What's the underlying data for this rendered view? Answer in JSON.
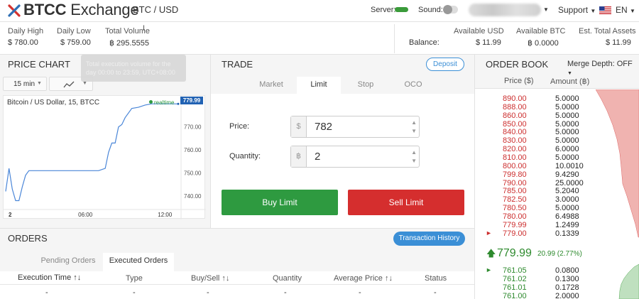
{
  "header": {
    "brand_bold": "BTCC",
    "brand_light": " Exchange",
    "pair": "BTC / USD",
    "server_label": "Server:",
    "sound_label": "Sound:",
    "support_label": "Support",
    "lang_label": "EN",
    "colors": {
      "server_ok": "#3a9b3a",
      "logo_red": "#d5332f",
      "logo_blue": "#2e6fb5"
    }
  },
  "stats": {
    "daily_high_label": "Daily High",
    "daily_high_value": "$ 780.00",
    "daily_low_label": "Daily Low",
    "daily_low_value": "$ 759.00",
    "total_volume_label": "Total Volume",
    "total_volume_value": "฿ 295.5555",
    "balance_label": "Balance:",
    "avail_usd_label": "Available USD",
    "avail_usd_value": "$ 11.99",
    "avail_btc_label": "Available BTC",
    "avail_btc_value": "฿ 0.0000",
    "est_assets_label": "Est. Total Assets",
    "est_assets_value": "$ 11.99"
  },
  "tooltip": {
    "line1": "Total execution volume for the",
    "line2": "day 00:00 to 23:59, UTC+08:00"
  },
  "price_chart": {
    "title": "PRICE CHART",
    "interval": "15 min",
    "chart_title": "Bitcoin / US Dollar, 15, BTCC",
    "realtime_label": "realtime",
    "current_price_tag": "779.99"
  },
  "chart_data": {
    "type": "line",
    "title": "Bitcoin / US Dollar, 15, BTCC",
    "x_ticks": [
      "2",
      "06:00",
      "12:00"
    ],
    "y_ticks": [
      740,
      750,
      760,
      770
    ],
    "ylim": [
      736,
      781
    ],
    "last_value": 779.99,
    "grid": false,
    "x": [
      "00:00",
      "00:15",
      "00:30",
      "00:45",
      "01:00",
      "01:15",
      "01:30",
      "01:45",
      "02:00",
      "03:00",
      "04:00",
      "05:00",
      "06:00",
      "07:00",
      "07:30",
      "07:45",
      "08:00",
      "08:15",
      "08:30",
      "08:45",
      "09:00",
      "09:30",
      "10:00",
      "10:30",
      "11:00",
      "11:30",
      "12:00",
      "12:30",
      "13:00"
    ],
    "values": [
      742,
      752,
      743,
      738,
      738,
      744,
      749,
      751,
      751,
      751,
      751,
      751,
      751,
      751,
      752,
      759,
      763,
      763,
      770,
      771,
      774,
      778,
      778.5,
      779.5,
      780,
      780,
      780,
      780,
      779.99
    ]
  },
  "trade": {
    "title": "TRADE",
    "deposit_label": "Deposit",
    "tabs": [
      "Market",
      "Limit",
      "Stop",
      "OCO"
    ],
    "active_tab": "Limit",
    "price_label": "Price:",
    "price_prefix": "$",
    "price_value": "782",
    "qty_label": "Quantity:",
    "qty_prefix": "฿",
    "qty_value": "2",
    "buy_label": "Buy Limit",
    "sell_label": "Sell Limit",
    "colors": {
      "buy": "#2e9a40",
      "sell": "#d52e2e"
    }
  },
  "orders": {
    "title": "ORDERS",
    "history_label": "Transaction History",
    "tabs": [
      "Pending Orders",
      "Executed Orders"
    ],
    "active_tab": "Executed Orders",
    "columns": [
      "Execution Time ↑↓",
      "Type",
      "Buy/Sell ↑↓",
      "Quantity",
      "Average Price ↑↓",
      "Status"
    ],
    "placeholder": "-"
  },
  "order_book": {
    "title": "ORDER BOOK",
    "merge_label": "Merge Depth: OFF",
    "price_header": "Price ($)",
    "amount_header": "Amount (฿)",
    "asks": [
      {
        "price": "890.00",
        "amount": "5.0000"
      },
      {
        "price": "888.00",
        "amount": "5.0000"
      },
      {
        "price": "860.00",
        "amount": "5.0000"
      },
      {
        "price": "850.00",
        "amount": "5.0000"
      },
      {
        "price": "840.00",
        "amount": "5.0000"
      },
      {
        "price": "830.00",
        "amount": "5.0000"
      },
      {
        "price": "820.00",
        "amount": "6.0000"
      },
      {
        "price": "810.00",
        "amount": "5.0000"
      },
      {
        "price": "800.00",
        "amount": "10.0010"
      },
      {
        "price": "799.80",
        "amount": "9.4290"
      },
      {
        "price": "790.00",
        "amount": "25.0000"
      },
      {
        "price": "785.00",
        "amount": "5.2040"
      },
      {
        "price": "782.50",
        "amount": "3.0000"
      },
      {
        "price": "780.50",
        "amount": "5.0000"
      },
      {
        "price": "780.00",
        "amount": "6.4988"
      },
      {
        "price": "779.99",
        "amount": "1.2499"
      },
      {
        "price": "779.00",
        "amount": "0.1339"
      }
    ],
    "last_price": "779.99",
    "last_change": "20.99 (2.77%)",
    "bids": [
      {
        "price": "761.05",
        "amount": "0.0800"
      },
      {
        "price": "761.02",
        "amount": "0.1300"
      },
      {
        "price": "761.01",
        "amount": "0.1728"
      },
      {
        "price": "761.00",
        "amount": "2.0000"
      }
    ],
    "colors": {
      "ask": "#cc2e2e",
      "bid": "#2e8a2e"
    }
  }
}
